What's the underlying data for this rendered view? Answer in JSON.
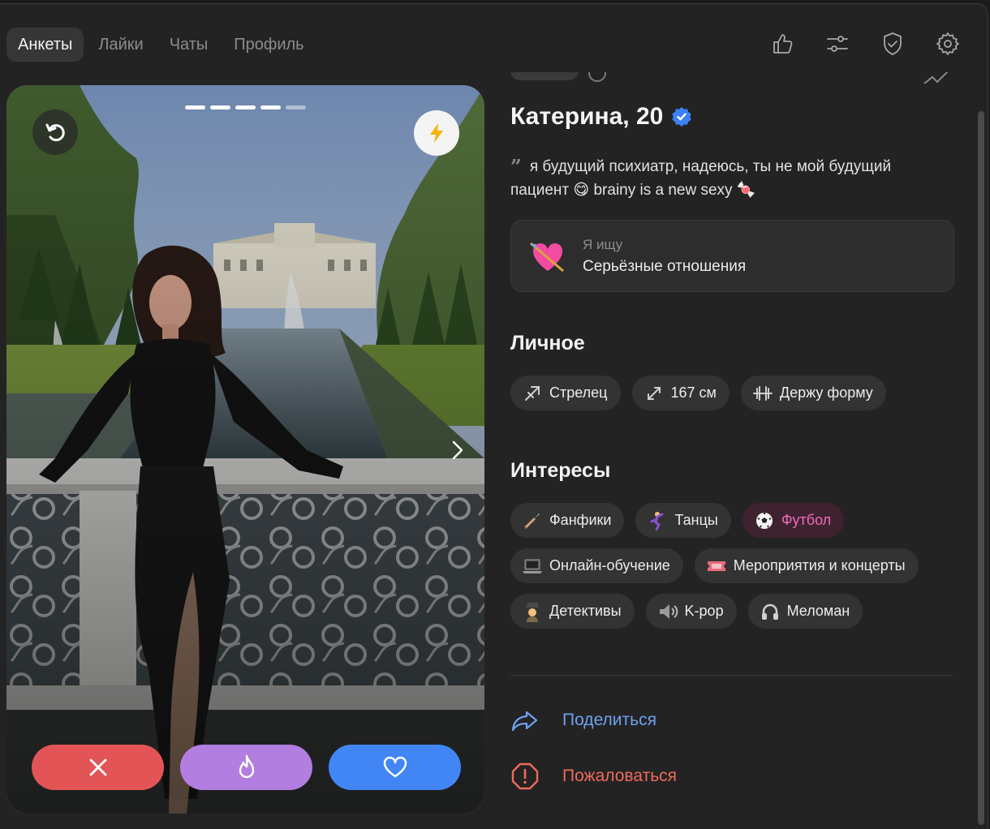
{
  "nav": {
    "tabs": [
      {
        "label": "Анкеты",
        "active": true
      },
      {
        "label": "Лайки",
        "active": false
      },
      {
        "label": "Чаты",
        "active": false
      },
      {
        "label": "Профиль",
        "active": false
      }
    ],
    "icons": [
      "thumbs-up-icon",
      "sliders-icon",
      "shield-check-icon",
      "gear-icon"
    ]
  },
  "card": {
    "photo_count": 5,
    "current_photo": 4,
    "buttons": {
      "rewind": "rewind-icon",
      "boost": "lightning-icon",
      "next": "chevron-right-icon",
      "dislike": "close-icon",
      "superlike": "flame-icon",
      "like": "heart-icon"
    },
    "colors": {
      "dislike": "#e35457",
      "superlike": "#b27ee0",
      "like": "#4286f5"
    }
  },
  "profile": {
    "name": "Катерина, 20",
    "verified": true,
    "bio": "я будущий психиатр, надеюсь, ты не мой будущий пациент 😋 brainy is a new sexy 🍬",
    "looking_for": {
      "label": "Я ищу",
      "value": "Серьёзные отношения",
      "icon": "heart-arrow-emoji"
    },
    "personal": {
      "title": "Личное",
      "chips": [
        {
          "label": "Стрелец",
          "icon": "sagittarius-icon"
        },
        {
          "label": "167 см",
          "icon": "height-arrows-icon"
        },
        {
          "label": "Держу форму",
          "icon": "dumbbell-icon"
        }
      ]
    },
    "interests": {
      "title": "Интересы",
      "rows": [
        [
          {
            "label": "Фанфики",
            "icon": "brush-emoji",
            "highlight": false
          },
          {
            "label": "Танцы",
            "icon": "dancer-emoji",
            "highlight": false
          },
          {
            "label": "Футбол",
            "icon": "soccer-ball-emoji",
            "highlight": true
          }
        ],
        [
          {
            "label": "Онлайн-обучение",
            "icon": "laptop-emoji",
            "highlight": false
          },
          {
            "label": "Мероприятия и концерты",
            "icon": "ticket-emoji",
            "highlight": false
          }
        ],
        [
          {
            "label": "Детективы",
            "icon": "detective-emoji",
            "highlight": false
          },
          {
            "label": "K-pop",
            "icon": "speaker-emoji",
            "highlight": false
          },
          {
            "label": "Меломан",
            "icon": "headphones-emoji",
            "highlight": false
          }
        ]
      ]
    },
    "actions": {
      "share": "Поделиться",
      "report": "Пожаловаться"
    }
  }
}
